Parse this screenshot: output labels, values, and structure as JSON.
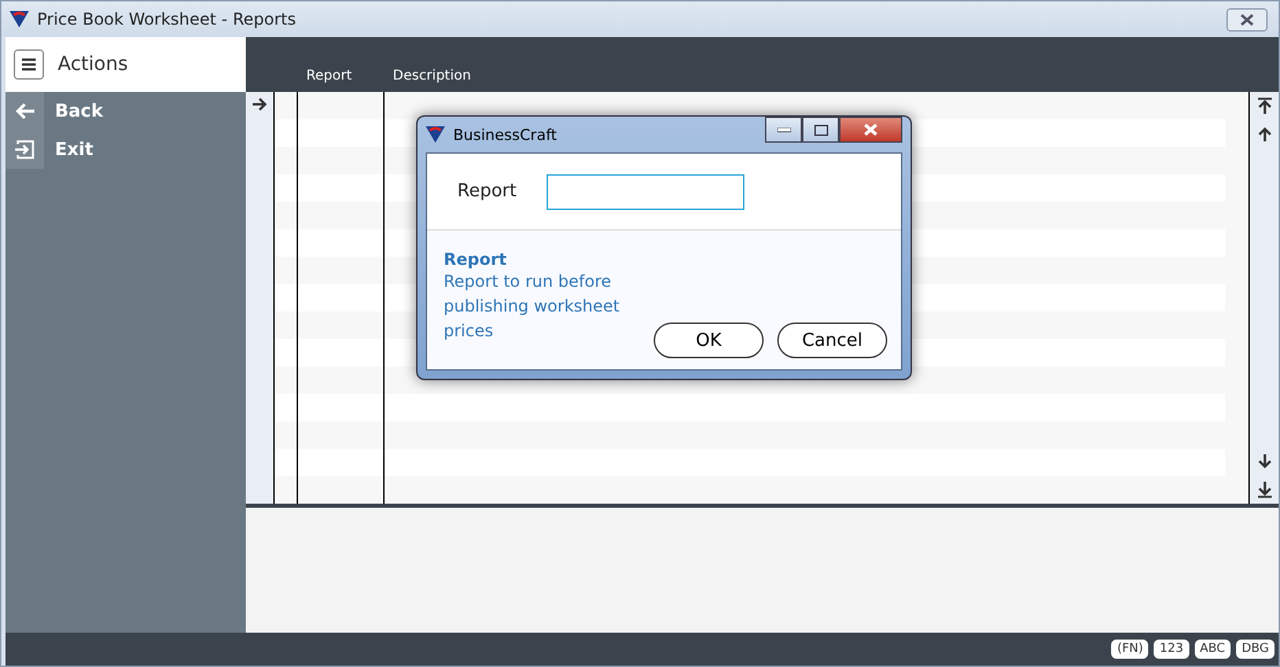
{
  "window": {
    "title": "Price Book Worksheet - Reports"
  },
  "sidebar": {
    "header": "Actions",
    "items": [
      {
        "label": "Back",
        "kind": "back"
      },
      {
        "label": "Exit",
        "kind": "exit"
      }
    ]
  },
  "table": {
    "columns": [
      "Report",
      "Description"
    ]
  },
  "dialog": {
    "title": "BusinessCraft",
    "field_label": "Report",
    "help_title": "Report",
    "help_text": "Report to run before publishing worksheet prices",
    "buttons": [
      "OK",
      "Cancel"
    ]
  },
  "status_bar": [
    "(FN)",
    "123",
    "ABC",
    "DBG"
  ]
}
